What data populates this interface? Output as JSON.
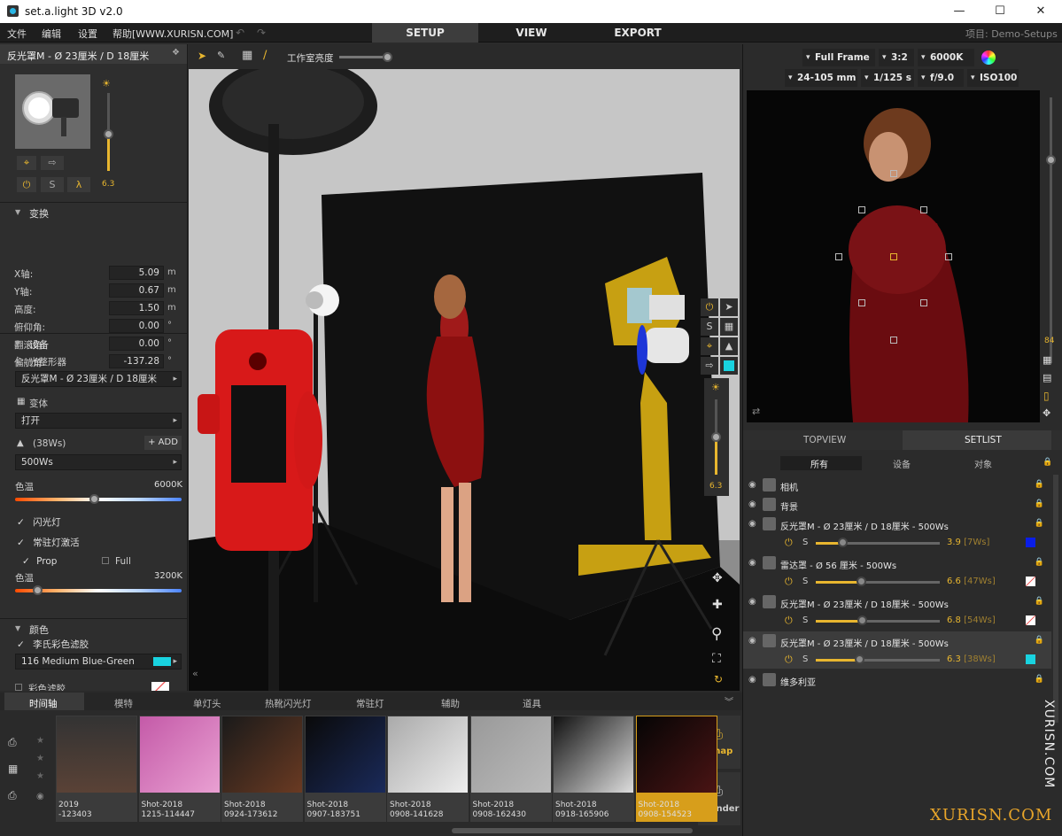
{
  "app": {
    "title": "set.a.light 3D v2.0"
  },
  "menu": [
    "文件",
    "编辑",
    "设置",
    "帮助[WWW.XURISN.COM]"
  ],
  "nav_tabs": [
    "SETUP",
    "VIEW",
    "EXPORT"
  ],
  "project": "项目: Demo-Setups",
  "left": {
    "header": "反光罩M - Ø 23厘米 / D 18厘米",
    "light_level": "6.3",
    "sections": {
      "transform": "变换",
      "equipment": "设备",
      "color": "颜色"
    },
    "transform": [
      {
        "label": "X轴:",
        "value": "5.09",
        "unit": "m"
      },
      {
        "label": "Y轴:",
        "value": "0.67",
        "unit": "m"
      },
      {
        "label": "高度:",
        "value": "1.50",
        "unit": "m"
      },
      {
        "label": "俯仰角:",
        "value": "0.00",
        "unit": "°"
      },
      {
        "label": "翻滚角:",
        "value": "0.00",
        "unit": "°"
      },
      {
        "label": "偏航角:",
        "value": "-137.28",
        "unit": "°"
      }
    ],
    "modifier_label": "光整形器",
    "modifier_value": "反光罩M - Ø 23厘米 / D 18厘米",
    "variant_label": "变体",
    "variant_value": "打开",
    "lamp": "(38Ws)",
    "add": "ADD",
    "power": "500Ws",
    "color_temp_label": "色温",
    "color_temp_value": "6000K",
    "flash": "闪光灯",
    "modeling": "常驻灯激活",
    "prop": "Prop",
    "full": "Full",
    "color_temp2_label": "色温",
    "color_temp2_value": "3200K",
    "gel_label": "李氏彩色滤胶",
    "gel_value": "116 Medium Blue-Green",
    "colored_gel": "彩色滤胶"
  },
  "viewport": {
    "brightness_label": "工作室亮度",
    "light_level": "6.3"
  },
  "bottom": {
    "tabs": [
      "时间轴",
      "模特",
      "单灯头",
      "热靴闪光灯",
      "常驻灯",
      "辅助",
      "道具"
    ],
    "shots": [
      {
        "l1": "2019",
        "l2": "-123403"
      },
      {
        "l1": "Shot-2018",
        "l2": "1215-114447"
      },
      {
        "l1": "Shot-2018",
        "l2": "0924-173612"
      },
      {
        "l1": "Shot-2018",
        "l2": "0907-183751"
      },
      {
        "l1": "Shot-2018",
        "l2": "0908-141628"
      },
      {
        "l1": "Shot-2018",
        "l2": "0908-162430"
      },
      {
        "l1": "Shot-2018",
        "l2": "0918-165906"
      },
      {
        "l1": "Shot-2018",
        "l2": "0908-154523"
      }
    ],
    "snap": "Snap",
    "render": "Render"
  },
  "camera": {
    "sensor": "Full Frame",
    "ratio": "3:2",
    "wb": "6000K",
    "lens": "24-105 mm",
    "shutter": "1/125 s",
    "aperture": "f/9.0",
    "iso": "ISO100",
    "zoom": "84"
  },
  "right_tabs": [
    "TOPVIEW",
    "SETLIST"
  ],
  "filters": [
    "所有",
    "设备",
    "对象"
  ],
  "setlist": [
    {
      "name": "相机"
    },
    {
      "name": "背景"
    },
    {
      "name": "反光罩M - Ø 23厘米 / D 18厘米 - 500Ws",
      "value": "3.9",
      "ws": "[7Ws]",
      "swatch": "#0a1ee8"
    },
    {
      "name": "雷达罩 - Ø 56 厘米 - 500Ws",
      "value": "6.6",
      "ws": "[47Ws]",
      "swatch": "none"
    },
    {
      "name": "反光罩M - Ø 23厘米 / D 18厘米 - 500Ws",
      "value": "6.8",
      "ws": "[54Ws]",
      "swatch": "none"
    },
    {
      "name": "反光罩M - Ø 23厘米 / D 18厘米 - 500Ws",
      "value": "6.3",
      "ws": "[38Ws]",
      "swatch": "#19d3e0"
    },
    {
      "name": "维多利亚"
    }
  ],
  "watermark": {
    "vertical": "XURISN.COM",
    "horizontal": "XURISN.COM"
  },
  "colors": {
    "accent": "#e8b62f",
    "dark": "#2b2b2b",
    "active_tab": "#3a3a3a"
  }
}
